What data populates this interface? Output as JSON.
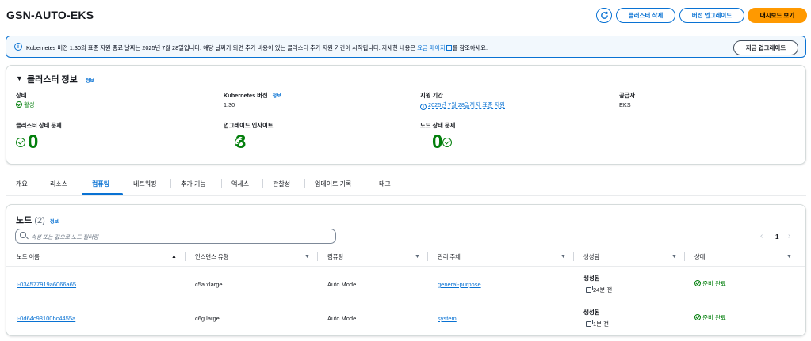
{
  "header": {
    "title": "GSN-AUTO-EKS",
    "delete_label": "클러스터 삭제",
    "upgrade_label": "버전 업그레이드",
    "dashboard_label": "대시보드 보기"
  },
  "banner": {
    "text_before": "Kubernetes 버전 1.30의 표준 지원 종료 날짜는 2025년 7월 28일입니다. 해당 날짜가 되면 추가 비용이 있는 클러스터 추가 지원 기간이 시작됩니다. 자세한 내용은 ",
    "link": "요금 페이지",
    "text_after": "를 참조하세요.",
    "button": "지금 업그레이드"
  },
  "cluster_info": {
    "title": "클러스터 정보",
    "info": "정보",
    "status_label": "상태",
    "status_value": "활성",
    "k8s_label": "Kubernetes 버전",
    "k8s_info": "정보",
    "k8s_value": "1.30",
    "support_label": "지원 기간",
    "support_value": "2025년 7월 28일까지 표준 지원",
    "provider_label": "공급자",
    "provider_value": "EKS",
    "health_label": "클러스터 상태 문제",
    "health_value": "0",
    "insights_label": "업그레이드 인사이트",
    "insights_value": "3",
    "node_health_label": "노드 상태 문제",
    "node_health_value": "0"
  },
  "tabs": [
    "개요",
    "리소스",
    "컴퓨팅",
    "네트워킹",
    "추가 기능",
    "액세스",
    "관찰성",
    "업데이트 기록",
    "태그"
  ],
  "nodes": {
    "title": "노드",
    "count": "(2)",
    "info": "정보",
    "search_placeholder": "속성 또는 값으로 노드 필터링",
    "page": "1",
    "columns": [
      "노드 이름",
      "인스턴스 유형",
      "컴퓨팅",
      "관리 주체",
      "생성됨",
      "상태"
    ],
    "rows": [
      {
        "name": "i-034577919a6066a65",
        "instance": "c5a.xlarge",
        "compute": "Auto Mode",
        "managed": "general-purpose",
        "created_label": "생성됨",
        "created": "24분 전",
        "status": "준비 완료"
      },
      {
        "name": "i-0d64c98100bc4455a",
        "instance": "c6g.large",
        "compute": "Auto Mode",
        "managed": "system",
        "created_label": "생성됨",
        "created": "1분 전",
        "status": "준비 완료"
      }
    ]
  },
  "colors": {
    "accent": "#0972d3",
    "primary_button": "#ff9900",
    "success": "#037f0c"
  }
}
